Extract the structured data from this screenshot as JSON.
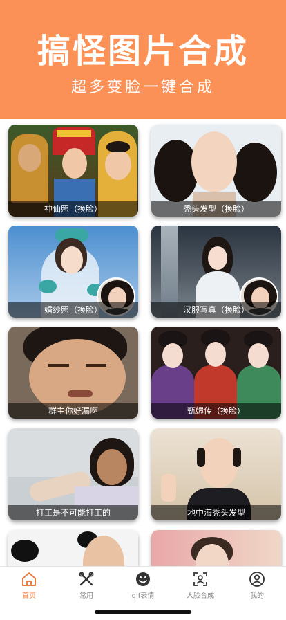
{
  "header": {
    "title": "搞怪图片合成",
    "subtitle": "超多变脸一键合成"
  },
  "cards": [
    {
      "caption": "神仙照（换脸）"
    },
    {
      "caption": "秃头发型（换脸）"
    },
    {
      "caption": "婚纱照（换脸）"
    },
    {
      "caption": "汉服写真（换脸）"
    },
    {
      "caption": "群主你好漏啊"
    },
    {
      "caption": "甄嬛传（换脸）"
    },
    {
      "caption": "打工是不可能打工的"
    },
    {
      "caption": "地中海秃头发型"
    }
  ],
  "tabs": [
    {
      "label": "首页",
      "icon": "home-icon",
      "active": true
    },
    {
      "label": "常用",
      "icon": "tools-icon",
      "active": false
    },
    {
      "label": "gif表情",
      "icon": "smiley-icon",
      "active": false
    },
    {
      "label": "人脸合成",
      "icon": "face-scan-icon",
      "active": false
    },
    {
      "label": "我的",
      "icon": "user-icon",
      "active": false
    }
  ],
  "colors": {
    "header_bg": "#fb9157",
    "active_tab": "#f07c3e",
    "inactive_tab": "#888888"
  }
}
